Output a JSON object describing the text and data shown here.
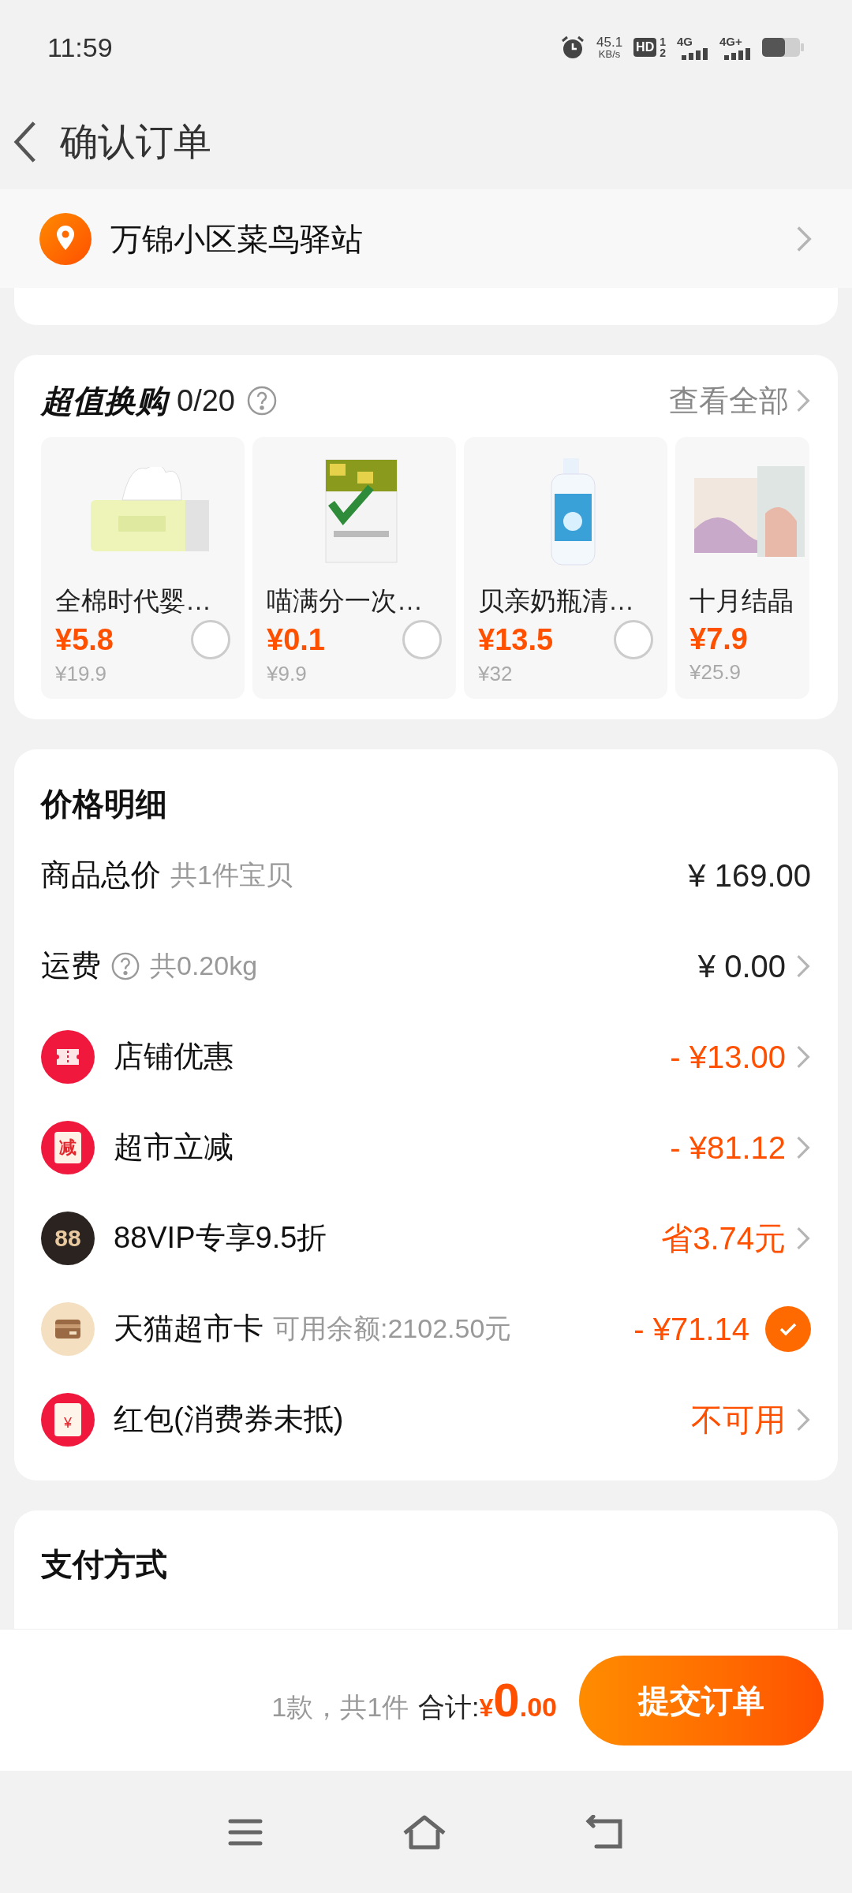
{
  "status_bar": {
    "time": "11:59",
    "speed": "45.1",
    "speed_unit": "KB/s",
    "hd": "HD",
    "sim1": "1",
    "sim2": "2",
    "net1": "4G",
    "net2": "4G+"
  },
  "header": {
    "title": "确认订单"
  },
  "address": {
    "name": "万锦小区菜鸟驿站"
  },
  "exchange": {
    "title": "超值换购",
    "count": "0/20",
    "view_all": "查看全部",
    "products": [
      {
        "name": "全棉时代婴…",
        "price": "¥5.8",
        "original": "¥19.9",
        "selected": false
      },
      {
        "name": "喵满分一次…",
        "price": "¥0.1",
        "original": "¥9.9",
        "selected": false
      },
      {
        "name": "贝亲奶瓶清…",
        "price": "¥13.5",
        "original": "¥32",
        "selected": false
      },
      {
        "name": "十月结晶",
        "price": "¥7.9",
        "original": "¥25.9"
      }
    ]
  },
  "price_detail": {
    "title": "价格明细",
    "rows": [
      {
        "kind": "total",
        "label": "商品总价",
        "note": "共1件宝贝",
        "value": "¥ 169.00"
      },
      {
        "kind": "shipping",
        "label": "运费",
        "note": "共0.20kg",
        "value": "¥ 0.00"
      },
      {
        "kind": "ticket",
        "label": "店铺优惠",
        "value": "- ¥13.00"
      },
      {
        "kind": "discount",
        "icon_text": "减",
        "label": "超市立减",
        "value": "- ¥81.12"
      },
      {
        "kind": "vip",
        "icon_text": "88",
        "label": "88VIP专享9.5折",
        "value": "省3.74元"
      },
      {
        "kind": "card",
        "label": "天猫超市卡",
        "note": "可用余额:2102.50元",
        "value": "- ¥71.14",
        "checked": true
      },
      {
        "kind": "packet",
        "icon_text": "¥",
        "label": "红包(消费券未抵)",
        "value": "不可用"
      }
    ]
  },
  "payment": {
    "title": "支付方式"
  },
  "footer": {
    "count": "1款，共1件",
    "total_label": "合计:",
    "currency": "¥",
    "integer": "0",
    "decimal": ".00",
    "submit": "提交订单"
  }
}
